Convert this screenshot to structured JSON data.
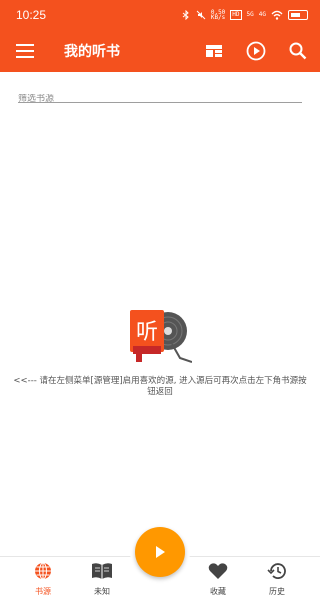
{
  "status_bar": {
    "time": "10:25",
    "speed": "0.50\nKB/s",
    "hd": "HD",
    "net5g": "5G",
    "net4g": "4G",
    "battery": "100"
  },
  "app_bar": {
    "title": "我的听书",
    "menu_icon": "menu-icon",
    "layout_icon": "layout-icon",
    "play_icon": "play-circle-icon",
    "search_icon": "search-icon"
  },
  "filter": {
    "placeholder": "筛选书源",
    "value": ""
  },
  "empty_state": {
    "badge_char": "听",
    "message": "<<--- 请在左侧菜单[源管理]启用喜欢的源, 进入源后可再次点击左下角书源按钮返回"
  },
  "bottom_nav": {
    "items": [
      {
        "label": "书源",
        "icon": "globe-icon",
        "active": true
      },
      {
        "label": "未知",
        "icon": "book-icon",
        "active": false
      },
      {
        "label": "收藏",
        "icon": "heart-icon",
        "active": false
      },
      {
        "label": "历史",
        "icon": "history-icon",
        "active": false
      }
    ],
    "fab_icon": "play-icon"
  },
  "colors": {
    "primary": "#f4511e",
    "fab": "#ff9800"
  }
}
